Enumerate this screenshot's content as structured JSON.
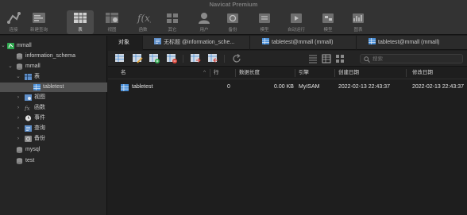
{
  "window": {
    "title": "Navicat Premium"
  },
  "toolbar": {
    "items": [
      {
        "label": "连接",
        "icon": "connection-icon"
      },
      {
        "label": "新建查询",
        "icon": "new-query-icon"
      },
      {
        "label": "表",
        "icon": "table-icon",
        "active": true
      },
      {
        "label": "视图",
        "icon": "view-icon"
      },
      {
        "label": "函数",
        "icon": "function-icon"
      },
      {
        "label": "其它",
        "icon": "other-icon"
      },
      {
        "label": "用户",
        "icon": "user-icon"
      },
      {
        "label": "备份",
        "icon": "backup-icon"
      },
      {
        "label": "模型",
        "icon": "model-icon"
      },
      {
        "label": "自动运行",
        "icon": "automation-icon"
      },
      {
        "label": "模型",
        "icon": "model-icon"
      },
      {
        "label": "图表",
        "icon": "chart-icon"
      }
    ]
  },
  "sidebar": {
    "tree": [
      {
        "label": "mmall",
        "icon": "connection-icon",
        "chevron": "⌄",
        "level": 0
      },
      {
        "label": "information_schema",
        "icon": "database-icon",
        "chevron": "",
        "level": 1
      },
      {
        "label": "mmall",
        "icon": "database-icon",
        "chevron": "⌄",
        "level": 1
      },
      {
        "label": "表",
        "icon": "tables-folder-icon",
        "chevron": "⌄",
        "level": 2
      },
      {
        "label": "tabletest",
        "icon": "table-icon",
        "chevron": "",
        "level": 3,
        "selected": true
      },
      {
        "label": "视图",
        "icon": "view-icon",
        "chevron": "›",
        "level": 2
      },
      {
        "label": "函数",
        "icon": "function-icon",
        "chevron": "›",
        "level": 2
      },
      {
        "label": "事件",
        "icon": "event-icon",
        "chevron": "›",
        "level": 2
      },
      {
        "label": "查询",
        "icon": "query-icon",
        "chevron": "›",
        "level": 2
      },
      {
        "label": "备份",
        "icon": "backup-icon",
        "chevron": "›",
        "level": 2
      },
      {
        "label": "mysql",
        "icon": "database-icon",
        "chevron": "",
        "level": 1
      },
      {
        "label": "test",
        "icon": "database-icon",
        "chevron": "",
        "level": 1
      }
    ]
  },
  "tabs": [
    {
      "label": "对象",
      "icon": "",
      "active": true
    },
    {
      "label": "无标题 @information_sche...",
      "icon": "query-icon"
    },
    {
      "label": "tabletest@mmall (mmall)",
      "icon": "table-icon"
    },
    {
      "label": "tabletest@mmall (mmall)",
      "icon": "table-icon"
    }
  ],
  "object_toolbar": {
    "buttons": [
      "open-table-icon",
      "design-table-icon",
      "new-table-icon",
      "delete-table-icon",
      "import-icon",
      "export-icon",
      "refresh-icon"
    ],
    "view_buttons": [
      "list-view-icon",
      "detail-view-icon",
      "grid-view-icon"
    ],
    "search_placeholder": "搜索"
  },
  "table": {
    "columns": [
      "名",
      "行",
      "数据长度",
      "引擎",
      "创建日期",
      "修改日期"
    ],
    "sort_indicator": "^",
    "rows": [
      {
        "name": "tabletest",
        "rows": "0",
        "data_length": "0.00 KB",
        "engine": "MyISAM",
        "created": "2022-02-13 22:43:37",
        "modified": "2022-02-13 22:43:37"
      }
    ]
  },
  "colors": {
    "table_icon": "#4a90d9",
    "database_icon": "#8c8c8c",
    "connection_icon": "#2fa84f",
    "folder_icon": "#5f8fc9",
    "selection": "#505050",
    "toolbar_bg": "#333333",
    "background": "#1e1e1e"
  }
}
